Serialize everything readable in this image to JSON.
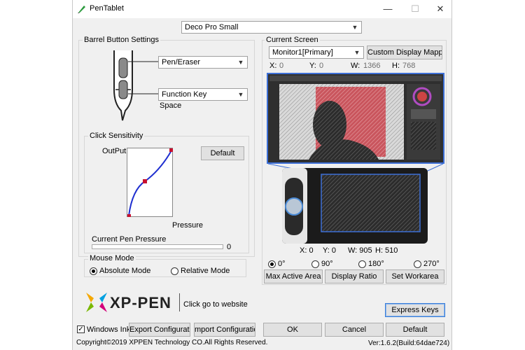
{
  "window": {
    "title": "PenTablet",
    "minimize": "—",
    "maximize": "☐",
    "close": "✕"
  },
  "device_select": {
    "value": "Deco Pro Small"
  },
  "barrel": {
    "group_label": "Barrel Button Settings",
    "button1_value": "Pen/Eraser",
    "button2_value": "Function Key",
    "button2_sub": "Space"
  },
  "sensitivity": {
    "group_label": "Click Sensitivity",
    "output_label": "OutPut",
    "default_btn": "Default",
    "pressure_label": "Pressure",
    "current_pressure_label": "Current Pen Pressure",
    "current_pressure_value": "0",
    "current_pressure_level": 0
  },
  "mouse_mode": {
    "group_label": "Mouse Mode",
    "absolute": "Absolute Mode",
    "relative": "Relative Mode",
    "selected": "absolute"
  },
  "screen": {
    "group_label": "Current Screen",
    "monitor_value": "Monitor1[Primary]",
    "custom_mapping_btn": "Custom Display Mapping",
    "x_label": "X:",
    "x_value": "0",
    "y_label": "Y:",
    "y_value": "0",
    "w_label": "W:",
    "w_value": "1366",
    "h_label": "H:",
    "h_value": "768"
  },
  "tablet_area": {
    "x_label": "X: 0",
    "y_label": "Y: 0",
    "w_label": "W: 905",
    "h_label": "H: 510"
  },
  "rotation": {
    "options": [
      "0°",
      "90°",
      "180°",
      "270°"
    ],
    "selected": "0°"
  },
  "area_buttons": {
    "max_active": "Max Active Area",
    "display_ratio": "Display Ratio",
    "set_workarea": "Set Workarea"
  },
  "brand": {
    "logo_text": "XP-PEN",
    "website_link": "Click go to website"
  },
  "express_keys_btn": "Express Keys",
  "footer": {
    "windows_ink": "Windows Ink",
    "windows_ink_checked": true,
    "export_config": "Export Configuration",
    "import_config": "mport Configuration",
    "ok": "OK",
    "cancel": "Cancel",
    "default": "Default",
    "copyright": "Copyright©2019 XPPEN Technology CO.All Rights Reserved.",
    "version": "Ver:1.6.2(Build:64dae724)"
  },
  "colors": {
    "accent_blue": "#3b7ed8",
    "curve_blue": "#1f2fd0",
    "curve_point": "#c8102e",
    "mapping_lines": "#3d6fd6"
  }
}
